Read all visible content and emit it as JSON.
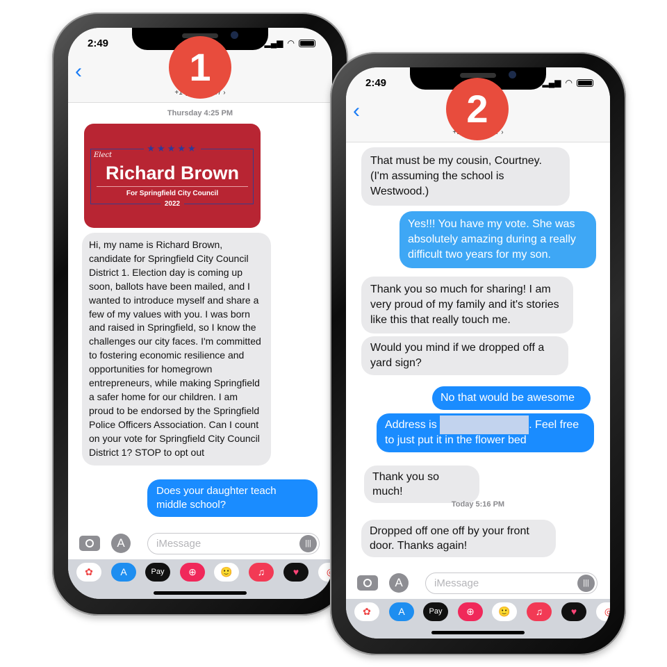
{
  "phones": [
    {
      "badge": "1",
      "status_time": "2:49",
      "contact": "+1 (5            )487 ›",
      "timestamp": "Thursday 4:25 PM",
      "poster": {
        "stars": "★★★★★",
        "elect": "Elect",
        "name": "Richard Brown",
        "subtitle": "For Springfield City Council",
        "year": "2022",
        "color": "#b82533"
      },
      "messages": [
        {
          "dir": "in",
          "text": "Hi, my name is Richard Brown, candidate for Springfield City Council District 1. Election day is coming up soon, ballots have been mailed, and I wanted to introduce myself and share a few of my values with you. I was born and raised in Springfield, so I know the challenges our city faces. I'm committed to fostering economic resilience and opportunities for homegrown entrepreneurs, while making Springfield a safer home for our children. I am proud to be endorsed by the Springfield Police Officers Association. Can I count on your vote for Springfield City Council District 1? STOP to opt out"
        },
        {
          "dir": "out",
          "text": "Does your daughter teach middle school?"
        }
      ],
      "input_placeholder": "iMessage"
    },
    {
      "badge": "2",
      "status_time": "2:49",
      "contact": "+1 (5            )487 ›",
      "timestamp": "Today 5:16 PM",
      "messages": [
        {
          "dir": "in",
          "text": "That must be my cousin, Courtney. (I'm assuming the school is Westwood.)"
        },
        {
          "dir": "out",
          "text": "Yes!!! You have my vote. She was absolutely amazing during a really difficult two years for my son."
        },
        {
          "dir": "in",
          "text": "Thank you so much for sharing! I am very proud of my family and it's stories like this that really touch me."
        },
        {
          "dir": "in",
          "text": "Would you mind if we dropped off a yard sign?"
        },
        {
          "dir": "out",
          "text": "No that would be awesome"
        },
        {
          "dir": "out",
          "text_before": "Address is",
          "text_after": ". Feel free to just put it in the flower bed"
        },
        {
          "dir": "in",
          "text": "Thank you so much!"
        },
        {
          "dir": "in",
          "text": "Dropped off one off by your front door. Thanks again!"
        }
      ],
      "input_placeholder": "iMessage"
    }
  ],
  "app_drawer": [
    "photos-icon",
    "app-store-icon",
    "apple-pay-icon",
    "search-images-icon",
    "memoji-icon",
    "music-icon",
    "digital-touch-icon"
  ],
  "apple_pay_label": "Pay",
  "colors": {
    "blue_bubble": "#1a8cff",
    "gray_bubble": "#e9e9eb",
    "badge": "#e84c3d",
    "ios_blue": "#1a7cf5"
  }
}
